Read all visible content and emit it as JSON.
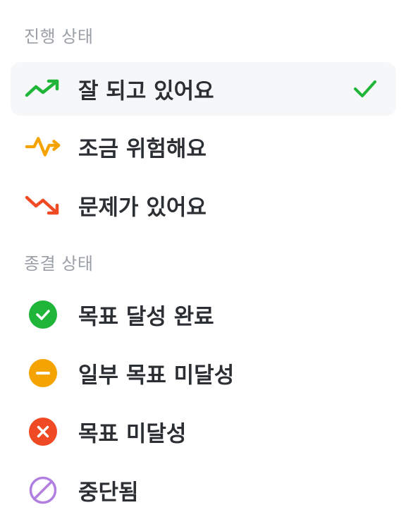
{
  "progress_section": {
    "title": "진행 상태",
    "items": [
      {
        "label": "잘 되고 있어요",
        "icon": "trend-up-icon",
        "color": "#1fb539",
        "selected": true
      },
      {
        "label": "조금 위험해요",
        "icon": "pulse-icon",
        "color": "#f5a300",
        "selected": false
      },
      {
        "label": "문제가 있어요",
        "icon": "trend-down-icon",
        "color": "#ef4a23",
        "selected": false
      }
    ]
  },
  "closing_section": {
    "title": "종결 상태",
    "items": [
      {
        "label": "목표 달성 완료",
        "icon": "check-circle-icon",
        "color": "#1fb539"
      },
      {
        "label": "일부 목표 미달성",
        "icon": "minus-circle-icon",
        "color": "#f5a300"
      },
      {
        "label": "목표 미달성",
        "icon": "x-circle-icon",
        "color": "#ef4a23"
      },
      {
        "label": "중단됨",
        "icon": "prohibited-icon",
        "color": "#b07fe0"
      }
    ]
  },
  "selected_check_icon": "check-icon"
}
